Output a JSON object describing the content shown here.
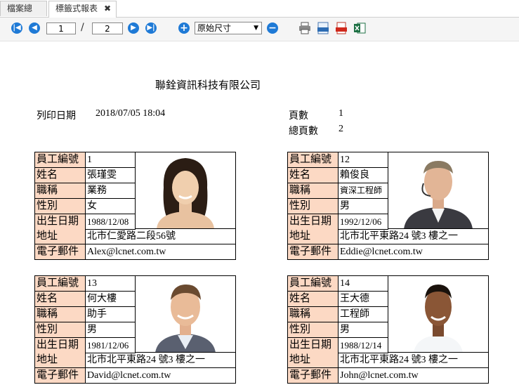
{
  "tabs": [
    {
      "label": "檔案總管"
    },
    {
      "label": "標籤式報表"
    }
  ],
  "toolbar": {
    "current_page": "1",
    "total_pages": "2",
    "separator": "/",
    "zoom_value": "原始尺寸",
    "brand_blue": "#1f7ad6"
  },
  "report": {
    "company": "聯銓資訊科技有限公司",
    "print_date_label": "列印日期",
    "print_date": "2018/07/05 18:04",
    "page_label": "頁數",
    "page_value": "1",
    "total_pages_label": "總頁數",
    "total_pages_value": "2",
    "label_fill": "#fcd9c4"
  },
  "labels": {
    "emp_no": "員工編號",
    "name": "姓名",
    "title": "職稱",
    "gender": "性別",
    "birth": "出生日期",
    "address": "地址",
    "email": "電子郵件"
  },
  "employees": [
    {
      "emp_no": "1",
      "name": "張瑾雯",
      "title": "業務",
      "gender": "女",
      "birth": "1988/12/08",
      "address": "北市仁愛路二段56號",
      "email": "Alex@lcnet.com.tw"
    },
    {
      "emp_no": "12",
      "name": "賴俊良",
      "title": "資深工程師",
      "gender": "男",
      "birth": "1992/12/06",
      "address": "北市北平東路24 號3 樓之一",
      "email": "Eddie@lcnet.com.tw"
    },
    {
      "emp_no": "13",
      "name": "何大樓",
      "title": "助手",
      "gender": "男",
      "birth": "1981/12/06",
      "address": "北市北平東路24 號3 樓之一",
      "email": "David@lcnet.com.tw"
    },
    {
      "emp_no": "14",
      "name": "王大德",
      "title": "工程師",
      "gender": "男",
      "birth": "1988/12/14",
      "address": "北市北平東路24 號3 樓之一",
      "email": "John@lcnet.com.tw"
    }
  ]
}
